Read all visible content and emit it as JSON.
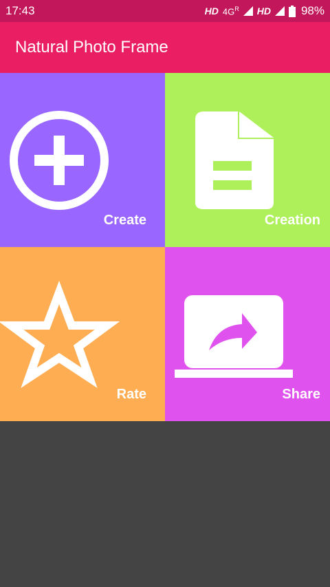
{
  "status_bar": {
    "time": "17:43",
    "hd1": "HD",
    "network": "4G",
    "roaming": "R",
    "hd2": "HD",
    "battery": "98%"
  },
  "app_bar": {
    "title": "Natural Photo Frame"
  },
  "tiles": [
    {
      "label": "Create",
      "icon": "add-circle-icon",
      "color": "#9966ff"
    },
    {
      "label": "Creation",
      "icon": "document-icon",
      "color": "#aef05a"
    },
    {
      "label": "Rate",
      "icon": "star-icon",
      "color": "#ffad52"
    },
    {
      "label": "Share",
      "icon": "share-laptop-icon",
      "color": "#e052ee"
    }
  ],
  "colors": {
    "status_bar": "#c2185b",
    "app_bar": "#e91e63",
    "background": "#444444"
  }
}
